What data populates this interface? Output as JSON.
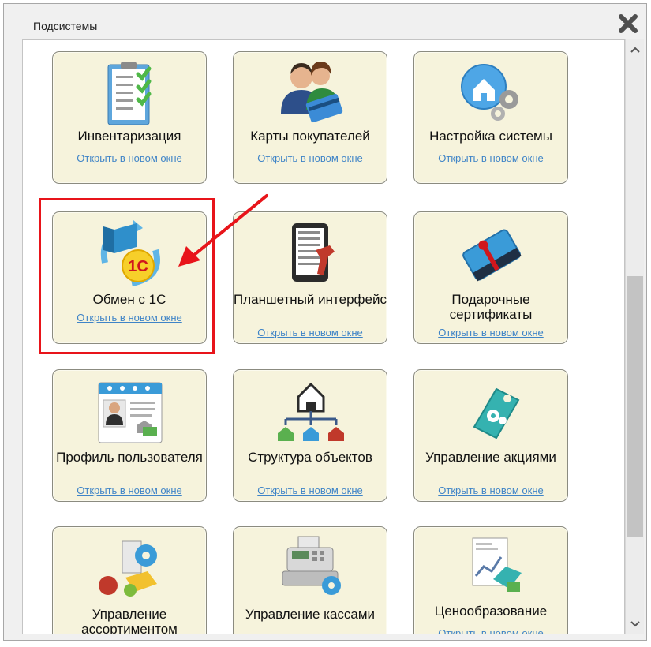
{
  "window": {
    "title": "Подсистемы"
  },
  "tiles": [
    {
      "name": "Инвентаризация",
      "link": "Открыть в новом окне"
    },
    {
      "name": "Карты покупателей",
      "link": "Открыть в новом окне"
    },
    {
      "name": "Настройка системы",
      "link": "Открыть в новом окне"
    },
    {
      "name": "Обмен с 1С",
      "link": "Открыть в новом окне"
    },
    {
      "name": "Планшетный интерфейс",
      "link": "Открыть в новом окне"
    },
    {
      "name": "Подарочные сертификаты",
      "link": "Открыть в новом окне"
    },
    {
      "name": "Профиль пользователя",
      "link": "Открыть в новом окне"
    },
    {
      "name": "Структура объектов",
      "link": "Открыть в новом окне"
    },
    {
      "name": "Управление акциями",
      "link": "Открыть в новом окне"
    },
    {
      "name": "Управление ассортиментом",
      "link": ""
    },
    {
      "name": "Управление кассами",
      "link": ""
    },
    {
      "name": "Ценообразование",
      "link": "Открыть в новом окне"
    }
  ],
  "icons": [
    "clipboard-checklist-icon",
    "customers-card-icon",
    "home-gears-icon",
    "exchange-1c-icon",
    "tablet-scanner-icon",
    "gift-card-icon",
    "user-profile-icon",
    "objects-structure-icon",
    "promo-tag-icon",
    "assortment-icon",
    "cash-register-icon",
    "pricing-icon"
  ],
  "icon_text": {
    "one_c_logo": "1С"
  },
  "colors": {
    "accent_red": "#e8141a",
    "link": "#3f84c7",
    "tile_bg": "#f6f3dc"
  }
}
